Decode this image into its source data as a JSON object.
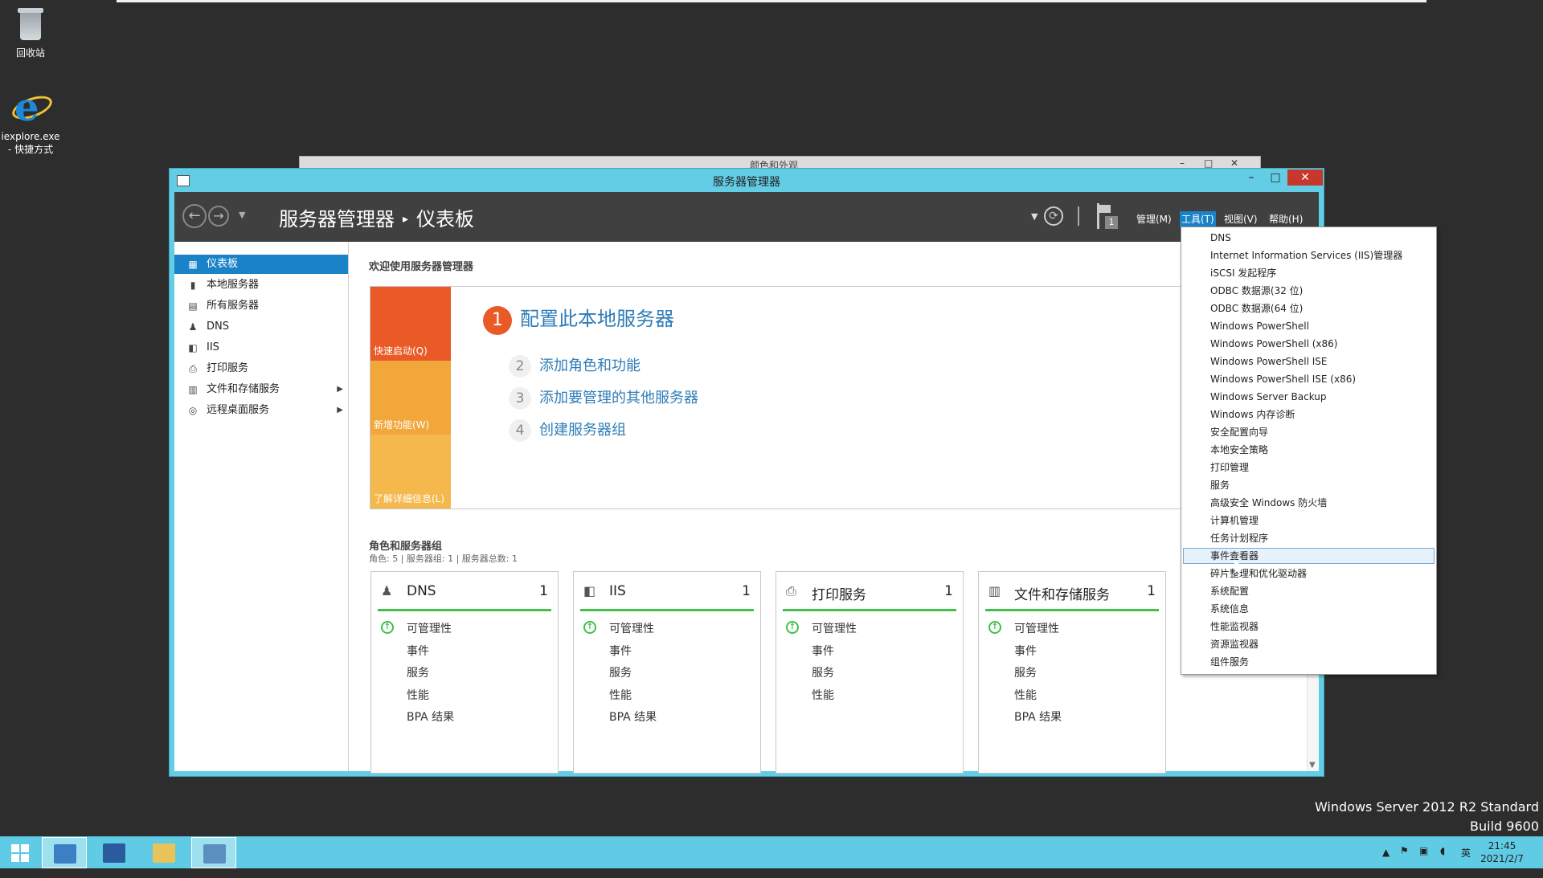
{
  "desktop": {
    "icons": [
      {
        "label": "回收站"
      },
      {
        "label": "iexplore.exe\n- 快捷方式"
      }
    ],
    "watermark": {
      "line1": "Windows Server 2012 R2 Standard",
      "line2": "Build 9600"
    }
  },
  "background_window": {
    "title": "颜色和外观"
  },
  "window": {
    "title": "服务器管理器",
    "controls": {
      "minimize": "–",
      "maximize": "□",
      "close": "✕"
    },
    "breadcrumb": {
      "root": "服务器管理器",
      "separator": "▸",
      "current": "仪表板"
    },
    "menu": [
      {
        "label": "管理(M)",
        "active": false
      },
      {
        "label": "工具(T)",
        "active": true
      },
      {
        "label": "视图(V)",
        "active": false
      },
      {
        "label": "帮助(H)",
        "active": false
      }
    ],
    "notifications_count": "1"
  },
  "sidebar": {
    "items": [
      {
        "label": "仪表板",
        "icon": "dashboard-icon",
        "active": true,
        "expandable": false
      },
      {
        "label": "本地服务器",
        "icon": "server-icon",
        "active": false,
        "expandable": false
      },
      {
        "label": "所有服务器",
        "icon": "servers-icon",
        "active": false,
        "expandable": false
      },
      {
        "label": "DNS",
        "icon": "dns-icon",
        "active": false,
        "expandable": false
      },
      {
        "label": "IIS",
        "icon": "iis-icon",
        "active": false,
        "expandable": false
      },
      {
        "label": "打印服务",
        "icon": "printer-icon",
        "active": false,
        "expandable": false
      },
      {
        "label": "文件和存储服务",
        "icon": "storage-icon",
        "active": false,
        "expandable": true
      },
      {
        "label": "远程桌面服务",
        "icon": "remote-desktop-icon",
        "active": false,
        "expandable": true
      }
    ]
  },
  "main": {
    "welcome": "欢迎使用服务器管理器",
    "tiles": [
      "快速启动(Q)",
      "新增功能(W)",
      "了解详细信息(L)"
    ],
    "steps": [
      {
        "num": "1",
        "label": "配置此本地服务器"
      },
      {
        "num": "2",
        "label": "添加角色和功能"
      },
      {
        "num": "3",
        "label": "添加要管理的其他服务器"
      },
      {
        "num": "4",
        "label": "创建服务器组"
      }
    ],
    "roles_title": "角色和服务器组",
    "roles_subtitle": "角色: 5 | 服务器组: 1 | 服务器总数: 1",
    "role_tiles": [
      {
        "name": "DNS",
        "count": "1",
        "icon": "dns-icon",
        "rows": [
          "可管理性",
          "事件",
          "服务",
          "性能",
          "BPA 结果"
        ]
      },
      {
        "name": "IIS",
        "count": "1",
        "icon": "iis-icon",
        "rows": [
          "可管理性",
          "事件",
          "服务",
          "性能",
          "BPA 结果"
        ]
      },
      {
        "name": "打印服务",
        "count": "1",
        "icon": "printer-icon",
        "rows": [
          "可管理性",
          "事件",
          "服务",
          "性能"
        ]
      },
      {
        "name": "文件和存储服务",
        "count": "1",
        "icon": "storage-icon",
        "rows": [
          "可管理性",
          "事件",
          "服务",
          "性能",
          "BPA 结果"
        ]
      }
    ]
  },
  "tools_menu": {
    "items": [
      "DNS",
      "Internet Information Services (IIS)管理器",
      "iSCSI 发起程序",
      "ODBC 数据源(32 位)",
      "ODBC 数据源(64 位)",
      "Windows PowerShell",
      "Windows PowerShell (x86)",
      "Windows PowerShell ISE",
      "Windows PowerShell ISE (x86)",
      "Windows Server Backup",
      "Windows 内存诊断",
      "安全配置向导",
      "本地安全策略",
      "打印管理",
      "服务",
      "高级安全 Windows 防火墙",
      "计算机管理",
      "任务计划程序",
      "事件查看器",
      "碎片整理和优化驱动器",
      "系统配置",
      "系统信息",
      "性能监视器",
      "资源监视器",
      "组件服务"
    ],
    "hovered_index": 18
  },
  "taskbar": {
    "tray_lang": "英",
    "time": "21:45",
    "date": "2021/2/7"
  }
}
